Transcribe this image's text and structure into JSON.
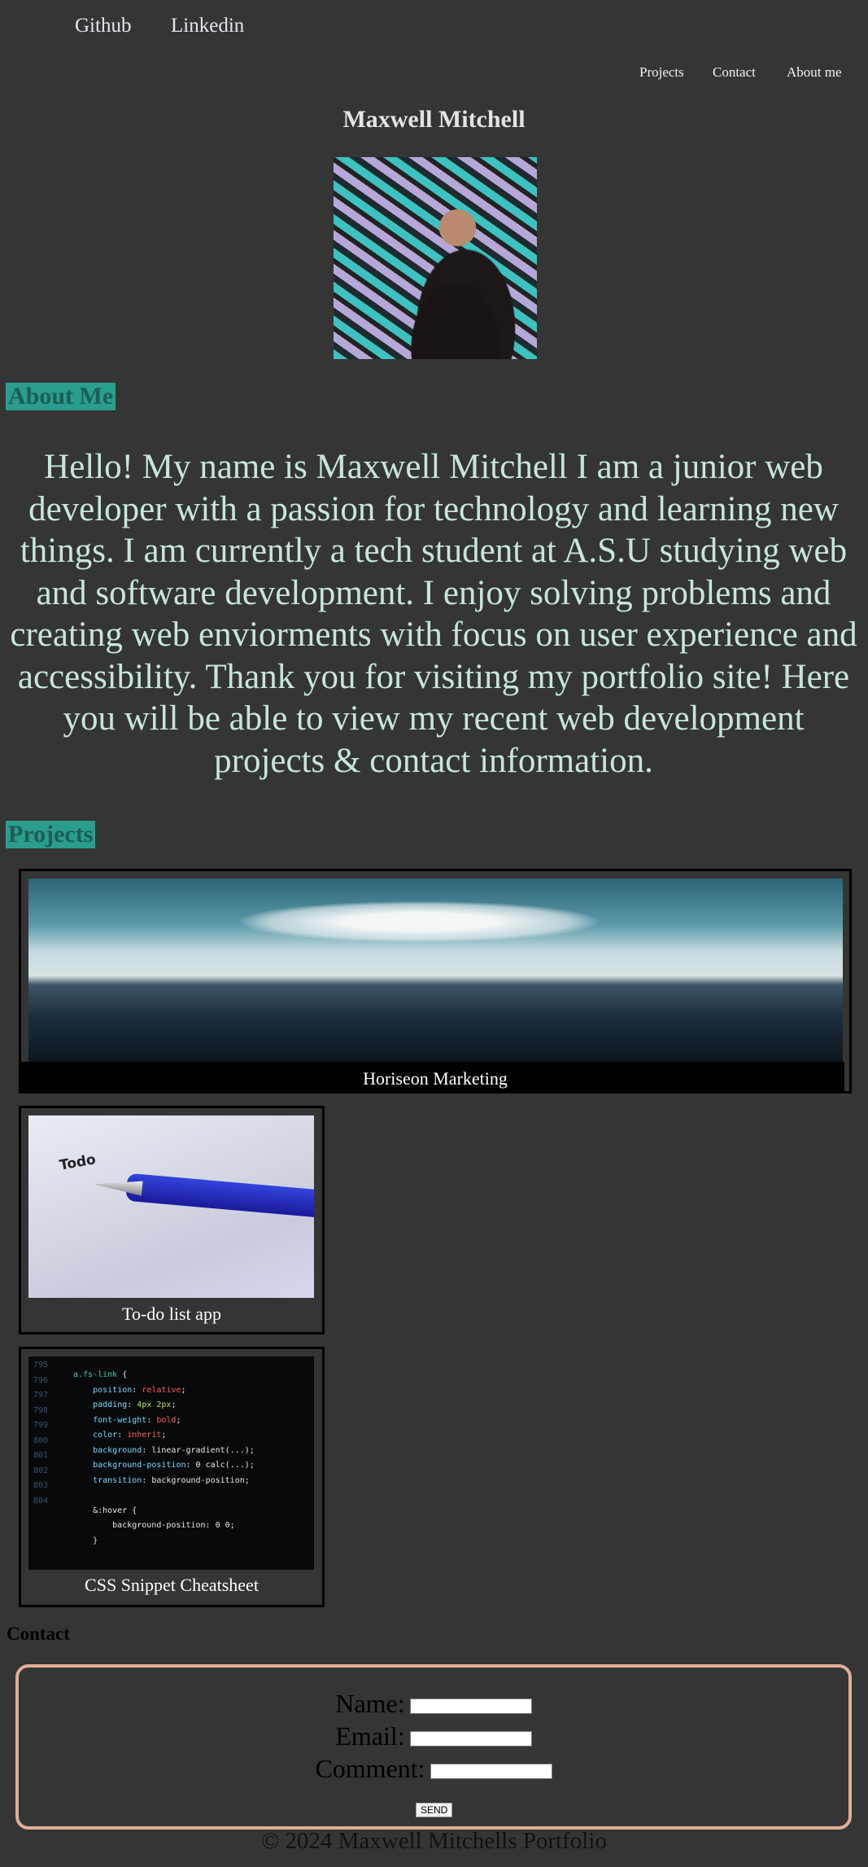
{
  "header": {
    "social_links": [
      "Github",
      "Linkedin"
    ],
    "nav": [
      "Projects",
      "Contact",
      "About me"
    ],
    "title": "Maxwell Mitchell"
  },
  "about": {
    "heading": "About Me",
    "text": "Hello! My name is Maxwell Mitchell I am a junior web developer with a passion for technology and learning new things. I am currently a tech student at A.S.U studying web and software development. I enjoy solving problems and creating web enviorments with focus on user experience and accessibility. Thank you for visiting my portfolio site! Here you will be able to view my recent web development projects & contact information."
  },
  "projects": {
    "heading": "Projects",
    "items": [
      {
        "title": "Horiseon Marketing"
      },
      {
        "title": "To-do list app",
        "image_text": "Todo"
      },
      {
        "title": "CSS Snippet Cheatsheet"
      }
    ]
  },
  "contact": {
    "heading": "Contact",
    "fields": [
      {
        "label": "Name:",
        "value": ""
      },
      {
        "label": "Email:",
        "value": ""
      },
      {
        "label": "Comment:",
        "value": ""
      }
    ],
    "submit": "SEND"
  },
  "footer": "© 2024 Maxwell Mitchells Portfolio",
  "colors": {
    "background": "#343534",
    "accent": "#2a9d8f",
    "form_border": "#e0ae93",
    "about_text": "#c7e6d9"
  }
}
